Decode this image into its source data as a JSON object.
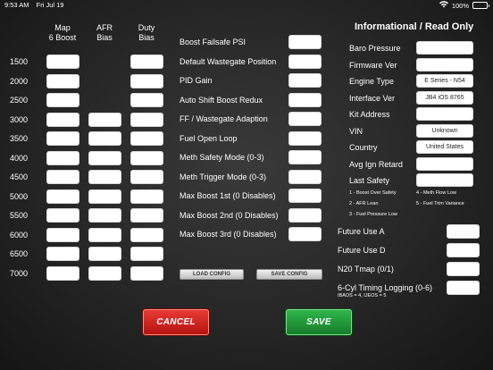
{
  "status_bar": {
    "time": "9:53 AM",
    "date": "Fri Jul 19",
    "battery": "100%"
  },
  "table": {
    "columns": [
      "Map\n6 Boost",
      "AFR\nBias",
      "Duty\nBias"
    ],
    "rows": [
      "1500",
      "2000",
      "2500",
      "3000",
      "3500",
      "4000",
      "4500",
      "5000",
      "5500",
      "6000",
      "6500",
      "7000"
    ]
  },
  "params": [
    "Boost Failsafe PSI",
    "Default Wastegate Position",
    "PID Gain",
    "Auto Shift Boost Redux",
    "FF / Wastegate Adaption",
    "Fuel Open Loop",
    "Meth Safety Mode (0-3)",
    "Meth Trigger Mode (0-3)",
    "Max Boost 1st (0 Disables)",
    "Max Boost 2nd (0 Disables)",
    "Max Boost 3rd (0 Disables)"
  ],
  "config_buttons": {
    "load": "LOAD CONFIG",
    "save": "SAVE CONFIG"
  },
  "info": {
    "title": "Informational / Read Only",
    "rows": [
      {
        "label": "Baro Pressure",
        "value": ""
      },
      {
        "label": "Firmware Ver",
        "value": ""
      },
      {
        "label": "Engine Type",
        "value": "E Series - N54"
      },
      {
        "label": "Interface Ver",
        "value": "JB4 iOS 8765"
      },
      {
        "label": "Kit Address",
        "value": ""
      },
      {
        "label": "VIN",
        "value": "Unknown"
      },
      {
        "label": "Country",
        "value": "United States"
      },
      {
        "label": "Avg Ign Retard",
        "value": ""
      },
      {
        "label": "Last Safety",
        "value": ""
      }
    ],
    "legend": {
      "l1": "1 - Boost Over Safety",
      "l2": "2 - AFR Lean",
      "l3": "3 - Fuel Pressure Low",
      "l4": "4 - Meth Flow Low",
      "l5": "5 - Fuel Trim Variance"
    }
  },
  "future": [
    "Future Use A",
    "Future Use D",
    "N20 Tmap (0/1)",
    "6-Cyl Timing Logging (0-6)"
  ],
  "future_note": "IBAOS = 4, IJEOS = 5",
  "buttons": {
    "cancel": "CANCEL",
    "save": "SAVE"
  },
  "colors": {
    "cancel": "#d42420",
    "save": "#22a03c",
    "background": "#2a2a2a"
  }
}
